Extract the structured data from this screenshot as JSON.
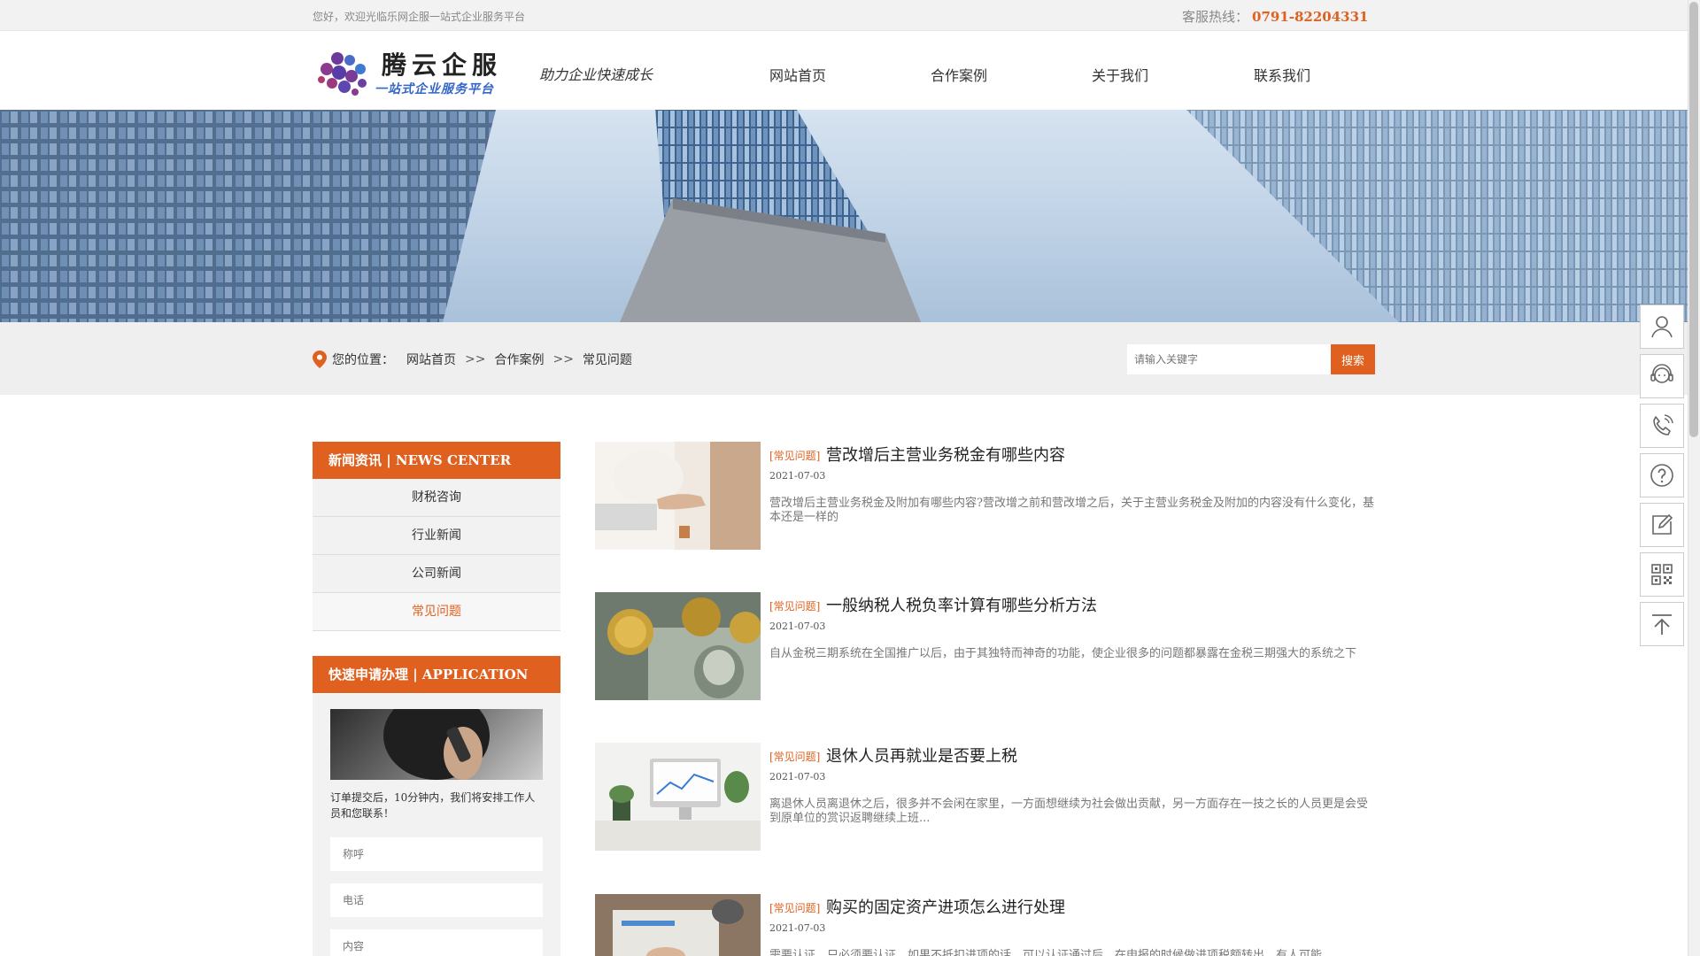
{
  "topbar": {
    "welcome": "您好，欢迎光临乐网企服一站式企业服务平台",
    "hotline_label": "客服热线：",
    "hotline_number": "0791-82204331"
  },
  "header": {
    "logo_name": "腾云企服",
    "logo_sub": "一站式企业服务平台",
    "slogan": "助力企业快速成长",
    "nav": [
      "网站首页",
      "合作案例",
      "关于我们",
      "联系我们"
    ]
  },
  "location": {
    "label": "您的位置：",
    "crumbs": [
      "网站首页",
      "合作案例",
      "常见问题"
    ],
    "separator": ">>"
  },
  "search": {
    "placeholder": "请输入关键字",
    "button": "搜索"
  },
  "sidebar": {
    "news_title": "新闻资讯 | NEWS CENTER",
    "news_items": [
      "财税咨询",
      "行业新闻",
      "公司新闻",
      "常见问题"
    ],
    "active_item": "常见问题",
    "apply_title": "快速申请办理 | APPLICATION",
    "apply_text": "订单提交后，10分钟内，我们将安排工作人员和您联系！",
    "fields": [
      "称呼",
      "电话",
      "内容"
    ]
  },
  "articles": [
    {
      "tag": "[常见问题]",
      "title": "营改增后主营业务税金有哪些内容",
      "date": "2021-07-03",
      "summary": "营改增后主营业务税金及附加有哪些内容?营改增之前和营改增之后，关于主营业务税金及附加的内容没有什么变化，基本还是一样的"
    },
    {
      "tag": "[常见问题]",
      "title": "一般纳税人税负率计算有哪些分析方法",
      "date": "2021-07-03",
      "summary": "自从金税三期系统在全国推广以后，由于其独特而神奇的功能，使企业很多的问题都暴露在金税三期强大的系统之下"
    },
    {
      "tag": "[常见问题]",
      "title": "退休人员再就业是否要上税",
      "date": "2021-07-03",
      "summary": "离退休人员离退休之后，很多并不会闲在家里，一方面想继续为社会做出贡献，另一方面存在一技之长的人员更是会受到原单位的赏识返聘继续上班..."
    },
    {
      "tag": "[常见问题]",
      "title": "购买的固定资产进项怎么进行处理",
      "date": "2021-07-03",
      "summary": "需要认证，只必须要认证，如果不抵扣进项的话，可以认证通过后，在申报的时候做进项税额转出，有人可能"
    }
  ],
  "float_bar": [
    "user-icon",
    "customer-service-icon",
    "phone-icon",
    "question-icon",
    "edit-icon",
    "qrcode-icon",
    "back-to-top-icon"
  ],
  "colors": {
    "accent": "#e0611f",
    "bar_bg": "#efefef"
  }
}
